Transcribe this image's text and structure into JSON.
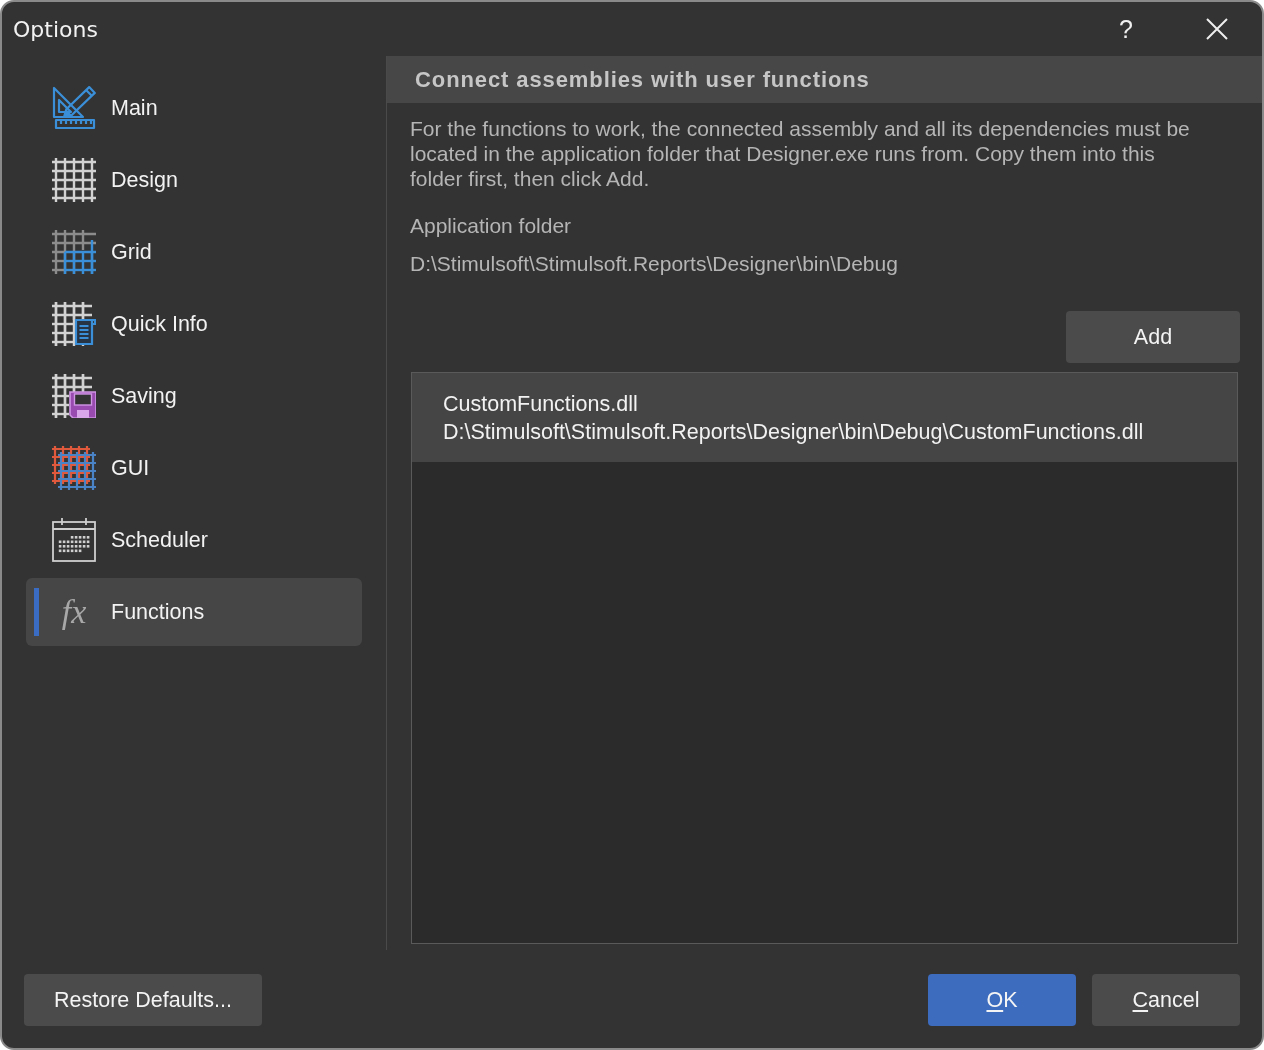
{
  "window": {
    "title": "Options",
    "help": "?"
  },
  "sidebar": {
    "items": [
      {
        "label": "Main",
        "kind": "ruler",
        "selected": false
      },
      {
        "label": "Design",
        "kind": "grid",
        "selected": false
      },
      {
        "label": "Grid",
        "kind": "bluegrid",
        "selected": false
      },
      {
        "label": "Quick Info",
        "kind": "document",
        "selected": false
      },
      {
        "label": "Saving",
        "kind": "floppy",
        "selected": false
      },
      {
        "label": "GUI",
        "kind": "mesh",
        "selected": false
      },
      {
        "label": "Scheduler",
        "kind": "calendar",
        "selected": false
      },
      {
        "label": "Functions",
        "kind": "glyph",
        "glyph": "fx",
        "selected": true
      }
    ]
  },
  "panel": {
    "title": "Connect assemblies with user functions",
    "description": "For the functions to work, the connected assembly and all its dependencies must be located in the application folder that Designer.exe runs from. Copy them into this folder first, then click Add.",
    "folder_label": "Application folder",
    "folder_path": "D:\\Stimulsoft\\Stimulsoft.Reports\\Designer\\bin\\Debug",
    "add_button": "Add",
    "assemblies": [
      {
        "name": "CustomFunctions.dll",
        "path": "D:\\Stimulsoft\\Stimulsoft.Reports\\Designer\\bin\\Debug\\CustomFunctions.dll",
        "selected": true
      }
    ]
  },
  "footer": {
    "restore_button": "Restore Defaults...",
    "buttons": [
      {
        "label": "OK",
        "kind": "primary",
        "access_key_underlined": true
      },
      {
        "label": "Cancel",
        "kind": "secondary",
        "access_key_underlined": true
      }
    ]
  }
}
